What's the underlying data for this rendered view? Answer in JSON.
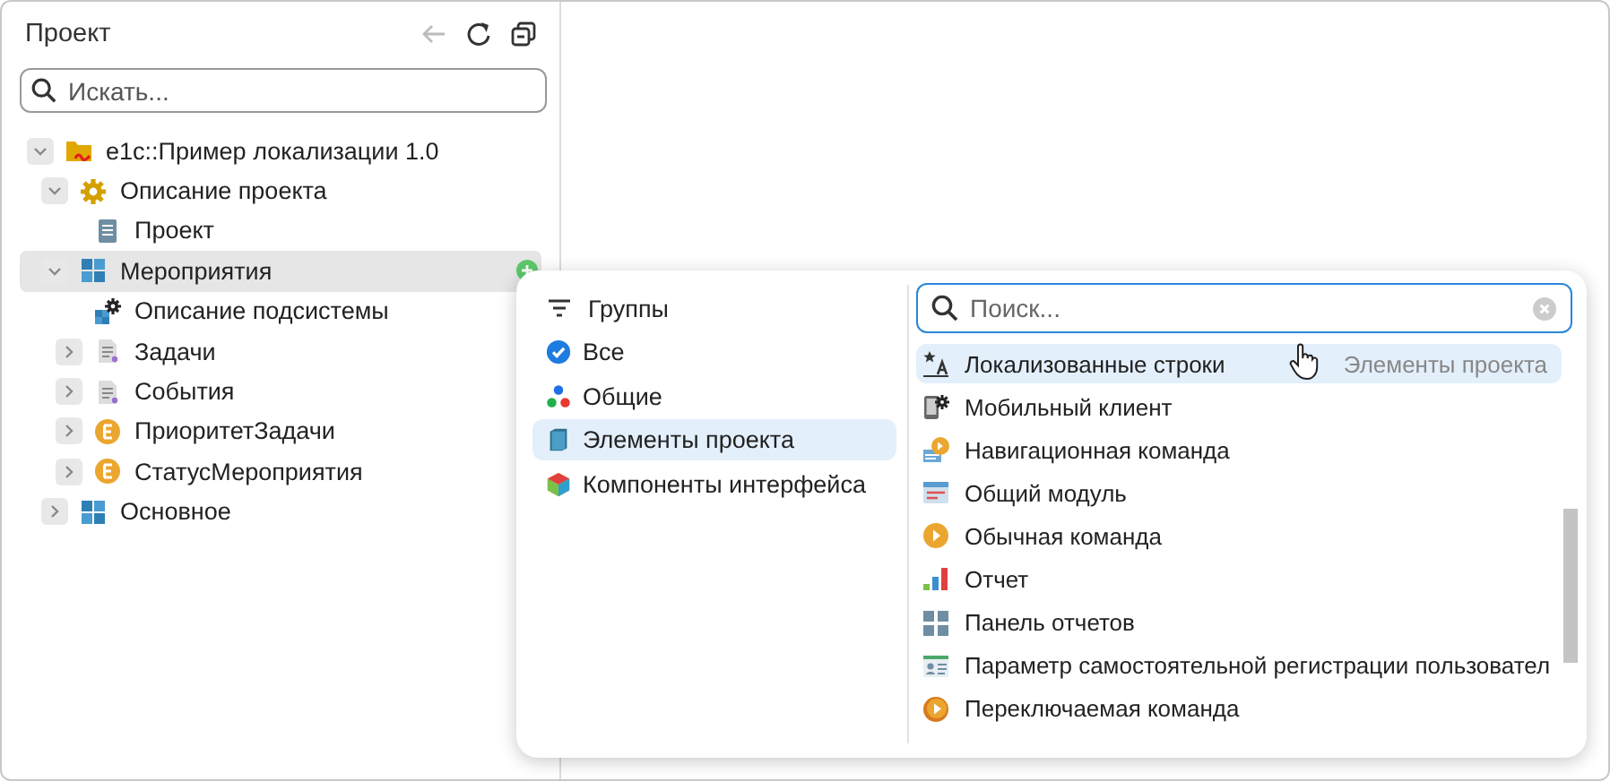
{
  "sidebar": {
    "title": "Проект",
    "toolbar": [
      {
        "kind": "back",
        "disabled": true
      },
      {
        "kind": "refresh",
        "disabled": false
      },
      {
        "kind": "collapse",
        "disabled": false
      }
    ],
    "search": {
      "placeholder": "Искать..."
    },
    "tree": [
      {
        "label": "e1c::Пример локализации 1.0",
        "kind": "project",
        "expanded": true,
        "selected": false,
        "children": [
          {
            "label": "Описание проекта",
            "kind": "settings",
            "expanded": true,
            "selected": false,
            "children": [
              {
                "label": "Проект",
                "kind": "document",
                "selected": false
              }
            ]
          },
          {
            "label": "Мероприятия",
            "kind": "subsystem",
            "expanded": true,
            "selected": true,
            "children": [
              {
                "label": "Описание подсистемы",
                "kind": "subsystem-settings",
                "selected": false
              },
              {
                "label": "Задачи",
                "kind": "catalog",
                "expanded": false,
                "selected": false
              },
              {
                "label": "События",
                "kind": "catalog",
                "expanded": false,
                "selected": false
              },
              {
                "label": "ПриоритетЗадачи",
                "kind": "enum",
                "expanded": false,
                "selected": false
              },
              {
                "label": "СтатусМероприятия",
                "kind": "enum",
                "expanded": false,
                "selected": false
              }
            ]
          },
          {
            "label": "Основное",
            "kind": "subsystem",
            "expanded": false,
            "selected": false
          }
        ]
      }
    ]
  },
  "popup": {
    "groups_title": "Группы",
    "groups": [
      {
        "label": "Все",
        "kind": "all",
        "selected": false
      },
      {
        "label": "Общие",
        "kind": "common",
        "selected": false
      },
      {
        "label": "Элементы проекта",
        "kind": "elements",
        "selected": true
      },
      {
        "label": "Компоненты интерфейса",
        "kind": "components",
        "selected": false
      }
    ],
    "search": {
      "placeholder": "Поиск..."
    },
    "items": [
      {
        "label": "Локализованные строки",
        "kind": "localized",
        "highlighted": true,
        "group": "Элементы проекта"
      },
      {
        "label": "Мобильный клиент",
        "kind": "mobile",
        "highlighted": false
      },
      {
        "label": "Навигационная команда",
        "kind": "navigation",
        "highlighted": false
      },
      {
        "label": "Общий модуль",
        "kind": "module",
        "highlighted": false
      },
      {
        "label": "Обычная команда",
        "kind": "command",
        "highlighted": false
      },
      {
        "label": "Отчет",
        "kind": "report",
        "highlighted": false
      },
      {
        "label": "Панель отчетов",
        "kind": "dashboard",
        "highlighted": false
      },
      {
        "label": "Параметр самостоятельной регистрации пользовател",
        "kind": "parameter",
        "highlighted": false
      },
      {
        "label": "Переключаемая команда",
        "kind": "toggle",
        "highlighted": false
      }
    ]
  }
}
